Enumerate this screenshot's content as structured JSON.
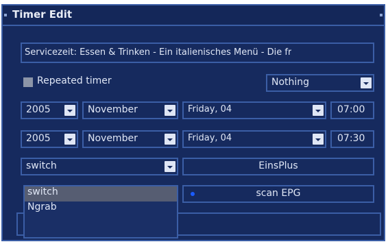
{
  "window": {
    "title": "Timer Edit"
  },
  "service_time": {
    "value": "Servicezeit: Essen & Trinken - Ein italienisches Menü - Die fr"
  },
  "repeated": {
    "label": "Repeated timer",
    "checked": false
  },
  "action": {
    "selected": "Nothing"
  },
  "start": {
    "year": "2005",
    "month": "November",
    "day": "Friday, 04",
    "time": "07:00"
  },
  "end": {
    "year": "2005",
    "month": "November",
    "day": "Friday, 04",
    "time": "07:30"
  },
  "type": {
    "selected": "switch",
    "options": [
      "switch",
      "Ngrab"
    ]
  },
  "channel": {
    "label": "EinsPlus"
  },
  "epg": {
    "label": "scan EPG"
  },
  "colors": {
    "background": "#162a5e",
    "border": "#3b5ea6",
    "text": "#dfe6f5",
    "selection": "#565d72",
    "dot": "#1b5cff"
  }
}
